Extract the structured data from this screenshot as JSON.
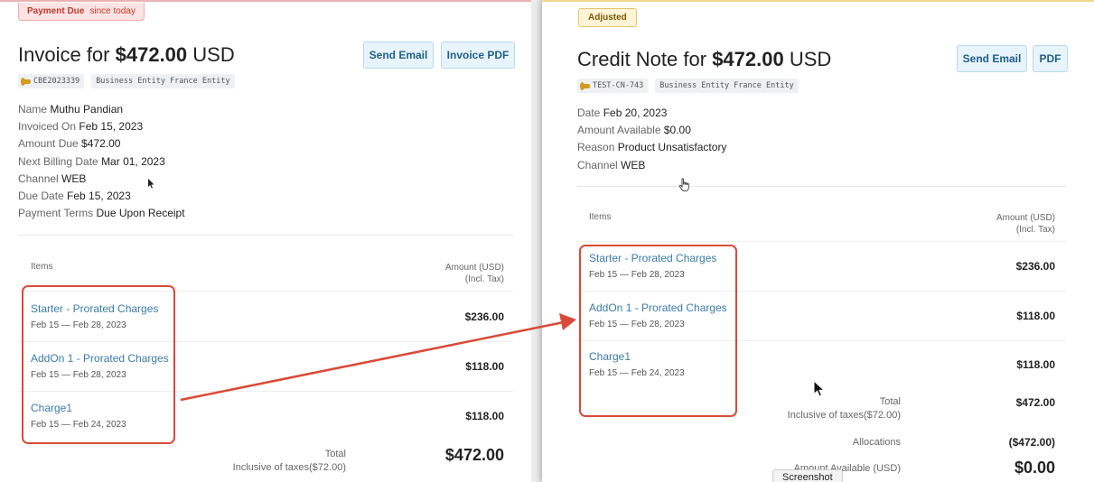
{
  "invoice": {
    "badge": {
      "label": "Payment Due",
      "since": "since today"
    },
    "title_prefix": "Invoice for",
    "title_amount": "$472.00",
    "title_currency": "USD",
    "send_email_label": "Send Email",
    "pdf_label": "Invoice PDF",
    "tags": {
      "id": "CBE2023339",
      "entity": "Business Entity France Entity"
    },
    "meta": [
      {
        "label": "Name",
        "value": "Muthu Pandian"
      },
      {
        "label": "Invoiced On",
        "value": "Feb 15, 2023"
      },
      {
        "label": "Amount Due",
        "value": "$472.00"
      },
      {
        "label": "Next Billing Date",
        "value": "Mar 01, 2023"
      },
      {
        "label": "Channel",
        "value": "WEB"
      },
      {
        "label": "Due Date",
        "value": "Feb 15, 2023"
      },
      {
        "label": "Payment Terms",
        "value": "Due Upon Receipt"
      }
    ],
    "items_header": "Items",
    "amount_header": "Amount (USD)",
    "amount_header_sub": "(Incl. Tax)",
    "items": [
      {
        "name": "Starter - Prorated Charges",
        "period": "Feb 15 — Feb 28, 2023",
        "amount": "$236.00"
      },
      {
        "name": "AddOn 1 - Prorated Charges",
        "period": "Feb 15 — Feb 28, 2023",
        "amount": "$118.00"
      },
      {
        "name": "Charge1",
        "period": "Feb 15 — Feb 24, 2023",
        "amount": "$118.00"
      }
    ],
    "total_label": "Total",
    "total_tax": "Inclusive of taxes($72.00)",
    "total_amount": "$472.00"
  },
  "credit_note": {
    "badge": "Adjusted",
    "title_prefix": "Credit Note for",
    "title_amount": "$472.00",
    "title_currency": "USD",
    "send_email_label": "Send Email",
    "pdf_label": "PDF",
    "tags": {
      "id": "TEST-CN-743",
      "entity": "Business Entity France Entity"
    },
    "meta": [
      {
        "label": "Date",
        "value": "Feb 20, 2023"
      },
      {
        "label": "Amount Available",
        "value": "$0.00"
      },
      {
        "label": "Reason",
        "value": "Product Unsatisfactory"
      },
      {
        "label": "Channel",
        "value": "WEB"
      }
    ],
    "items_header": "Items",
    "amount_header": "Amount (USD)",
    "amount_header_sub": "(Incl. Tax)",
    "items": [
      {
        "name": "Starter - Prorated Charges",
        "period": "Feb 15 — Feb 28, 2023",
        "amount": "$236.00"
      },
      {
        "name": "AddOn 1 - Prorated Charges",
        "period": "Feb 15 — Feb 28, 2023",
        "amount": "$118.00"
      },
      {
        "name": "Charge1",
        "period": "Feb 15 — Feb 24, 2023",
        "amount": "$118.00"
      }
    ],
    "total_label": "Total",
    "total_tax": "Inclusive of taxes($72.00)",
    "total_amount": "$472.00",
    "allocations_label": "Allocations",
    "allocations_value": "($472.00)",
    "available_label": "Amount Available (USD)",
    "available_value": "$0.00"
  },
  "tooltip": "Screenshot",
  "colors": {
    "highlight": "#d94b38",
    "link": "#3a7ca5",
    "button": "#1f5f8b"
  }
}
